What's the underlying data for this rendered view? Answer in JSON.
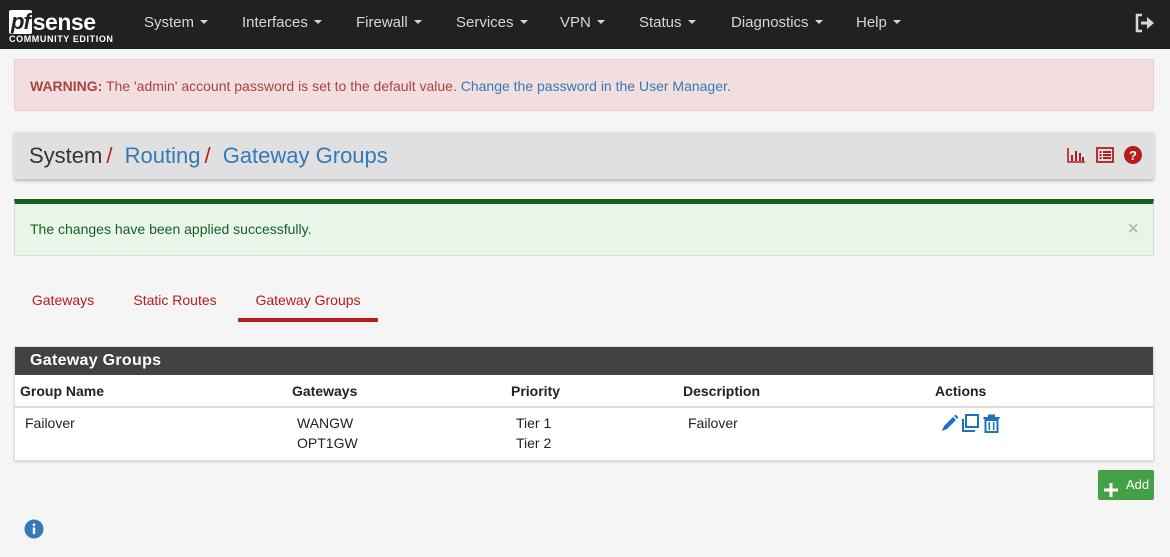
{
  "brand": {
    "logo_pf": "pf",
    "logo_sense": "sense",
    "edition": "COMMUNITY EDITION"
  },
  "nav": {
    "items": [
      {
        "label": "System"
      },
      {
        "label": "Interfaces"
      },
      {
        "label": "Firewall"
      },
      {
        "label": "Services"
      },
      {
        "label": "VPN"
      },
      {
        "label": "Status"
      },
      {
        "label": "Diagnostics"
      },
      {
        "label": "Help"
      }
    ],
    "logout_icon": "sign-out-icon"
  },
  "warning": {
    "prefix": "WARNING:",
    "text": " The 'admin' account password is set to the default value. ",
    "link": "Change the password in the User Manager."
  },
  "breadcrumb": {
    "root": "System",
    "level1": "Routing",
    "current": "Gateway Groups",
    "separator": "/"
  },
  "header_icons": [
    "bar-chart-icon",
    "list-icon",
    "help-icon"
  ],
  "success": {
    "text": "The changes have been applied successfully.",
    "close": "×"
  },
  "tabs": [
    {
      "label": "Gateways",
      "active": false
    },
    {
      "label": "Static Routes",
      "active": false
    },
    {
      "label": "Gateway Groups",
      "active": true
    }
  ],
  "panel": {
    "title": "Gateway Groups",
    "columns": [
      "Group Name",
      "Gateways",
      "Priority",
      "Description",
      "Actions"
    ],
    "rows": [
      {
        "group_name": "Failover",
        "gateways": [
          "WANGW",
          "OPT1GW"
        ],
        "priorities": [
          "Tier 1",
          "Tier 2"
        ],
        "description": "Failover",
        "actions": [
          "edit-icon",
          "copy-icon",
          "delete-icon"
        ]
      }
    ]
  },
  "add_button": {
    "label": "Add"
  },
  "colors": {
    "navbar": "#212121",
    "accent_red": "#b71c1c",
    "link_blue": "#337ab7",
    "success_green": "#1b5e20",
    "add_green": "#43a047",
    "action_blue": "#1e73be"
  }
}
